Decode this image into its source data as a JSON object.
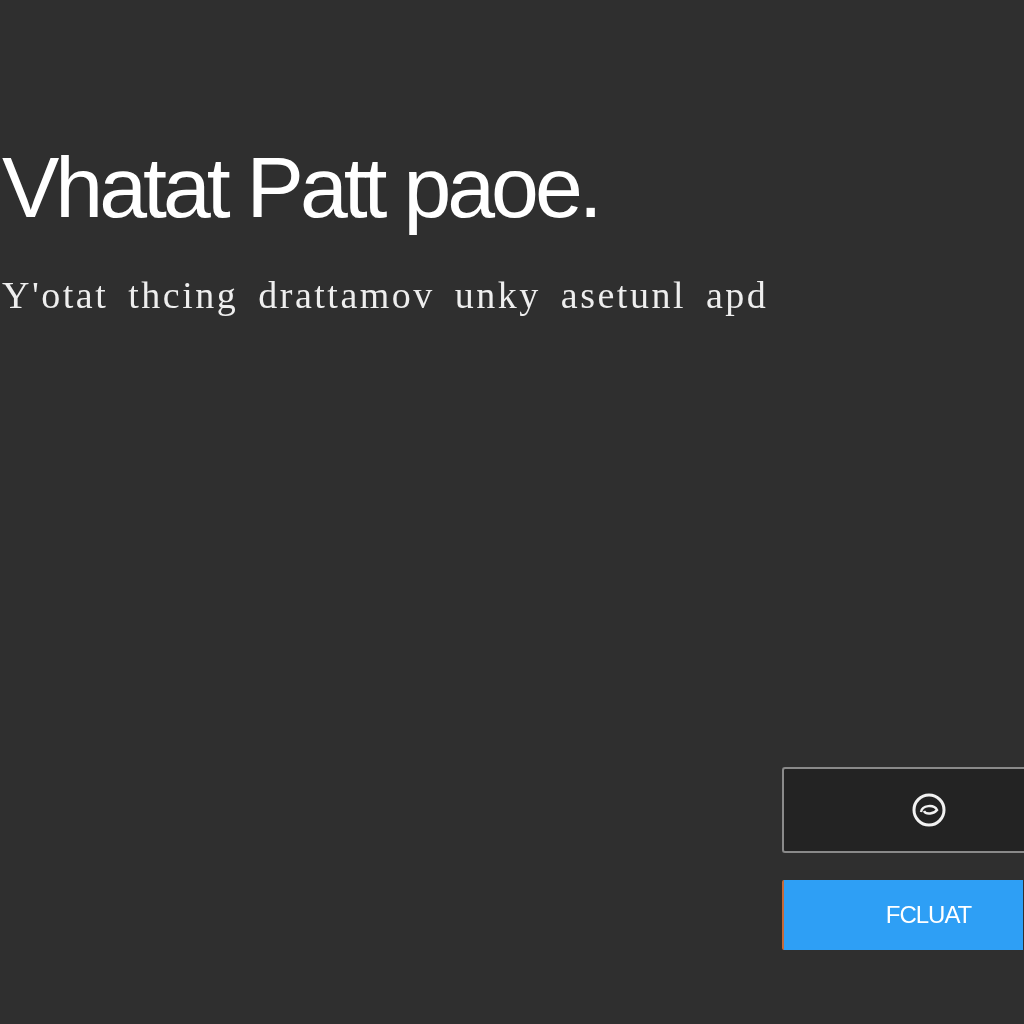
{
  "heading": "Vhatat Patt paoe.",
  "subtitle": "Y'otat thcing drattamov unky asetunl apd",
  "button": {
    "label": "FCLUAT"
  }
}
